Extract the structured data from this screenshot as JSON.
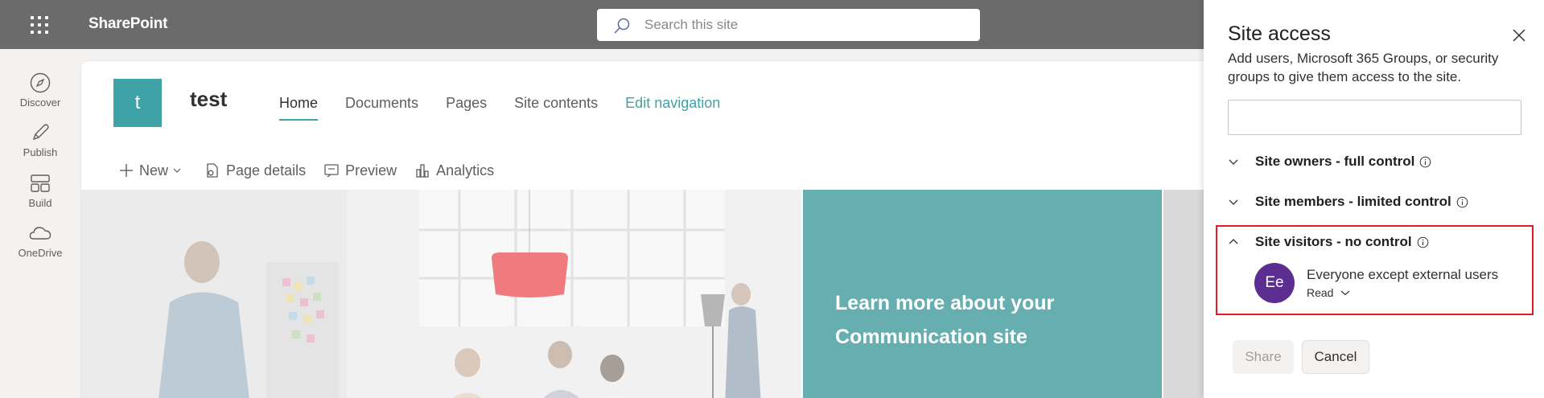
{
  "suitebar": {
    "app_name": "SharePoint",
    "search_placeholder": "Search this site"
  },
  "rail": {
    "items": [
      {
        "label": "Discover",
        "icon": "compass-icon"
      },
      {
        "label": "Publish",
        "icon": "pen-icon"
      },
      {
        "label": "Build",
        "icon": "layout-icon"
      },
      {
        "label": "OneDrive",
        "icon": "cloud-icon"
      }
    ]
  },
  "site": {
    "logo_letter": "t",
    "title": "test",
    "nav": [
      {
        "label": "Home",
        "active": true
      },
      {
        "label": "Documents"
      },
      {
        "label": "Pages"
      },
      {
        "label": "Site contents"
      },
      {
        "label": "Edit navigation"
      }
    ],
    "commands": {
      "new": "New",
      "page_details": "Page details",
      "preview": "Preview",
      "analytics": "Analytics"
    },
    "hero_text": "Learn more about your Communication site"
  },
  "panel": {
    "title": "Site access",
    "description": "Add users, Microsoft 365 Groups, or security groups to give them access to the site.",
    "input_value": "",
    "groups": [
      {
        "label": "Site owners - full control",
        "expanded": false
      },
      {
        "label": "Site members - limited control",
        "expanded": false
      },
      {
        "label": "Site visitors - no control",
        "expanded": true
      }
    ],
    "member": {
      "initials": "Ee",
      "name": "Everyone except external users",
      "role": "Read"
    },
    "share_label": "Share",
    "cancel_label": "Cancel"
  },
  "colors": {
    "suitebar": "#6b6b6b",
    "accent": "#3fa2a6",
    "hero_teal": "#67aeb0",
    "avatar": "#5c2e91",
    "highlight_border": "#e01b22"
  }
}
